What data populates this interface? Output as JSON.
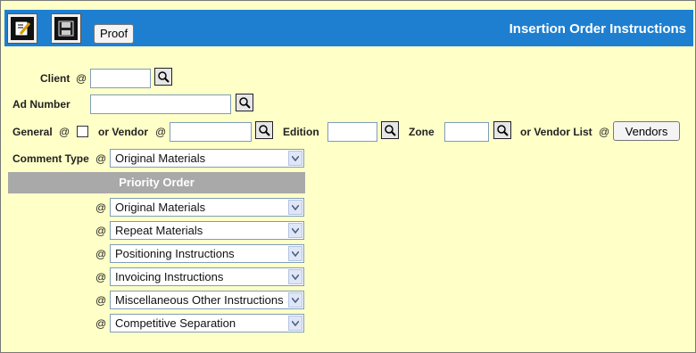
{
  "header": {
    "title": "Insertion Order Instructions",
    "proof_label": "Proof",
    "edit_icon": "edit-document-icon",
    "save_icon": "floppy-save-icon"
  },
  "form": {
    "at": "@",
    "client_label": "Client",
    "ad_number_label": "Ad Number",
    "general_label": "General",
    "or_vendor_label": "or Vendor",
    "edition_label": "Edition",
    "zone_label": "Zone",
    "or_vendor_list_label": "or Vendor List",
    "vendors_button": "Vendors",
    "comment_type_label": "Comment Type",
    "comment_type_value": "Original Materials",
    "lookup_icon": "magnifier-lookup-icon"
  },
  "priority": {
    "header": "Priority Order",
    "items": [
      "Original Materials",
      "Repeat Materials",
      "Positioning Instructions",
      "Invoicing Instructions",
      "Miscellaneous Other Instructions",
      "Competitive Separation"
    ]
  },
  "colors": {
    "titlebar": "#1e7fd0",
    "background": "#ffffc8",
    "priority_bar": "#a9a9a9"
  }
}
